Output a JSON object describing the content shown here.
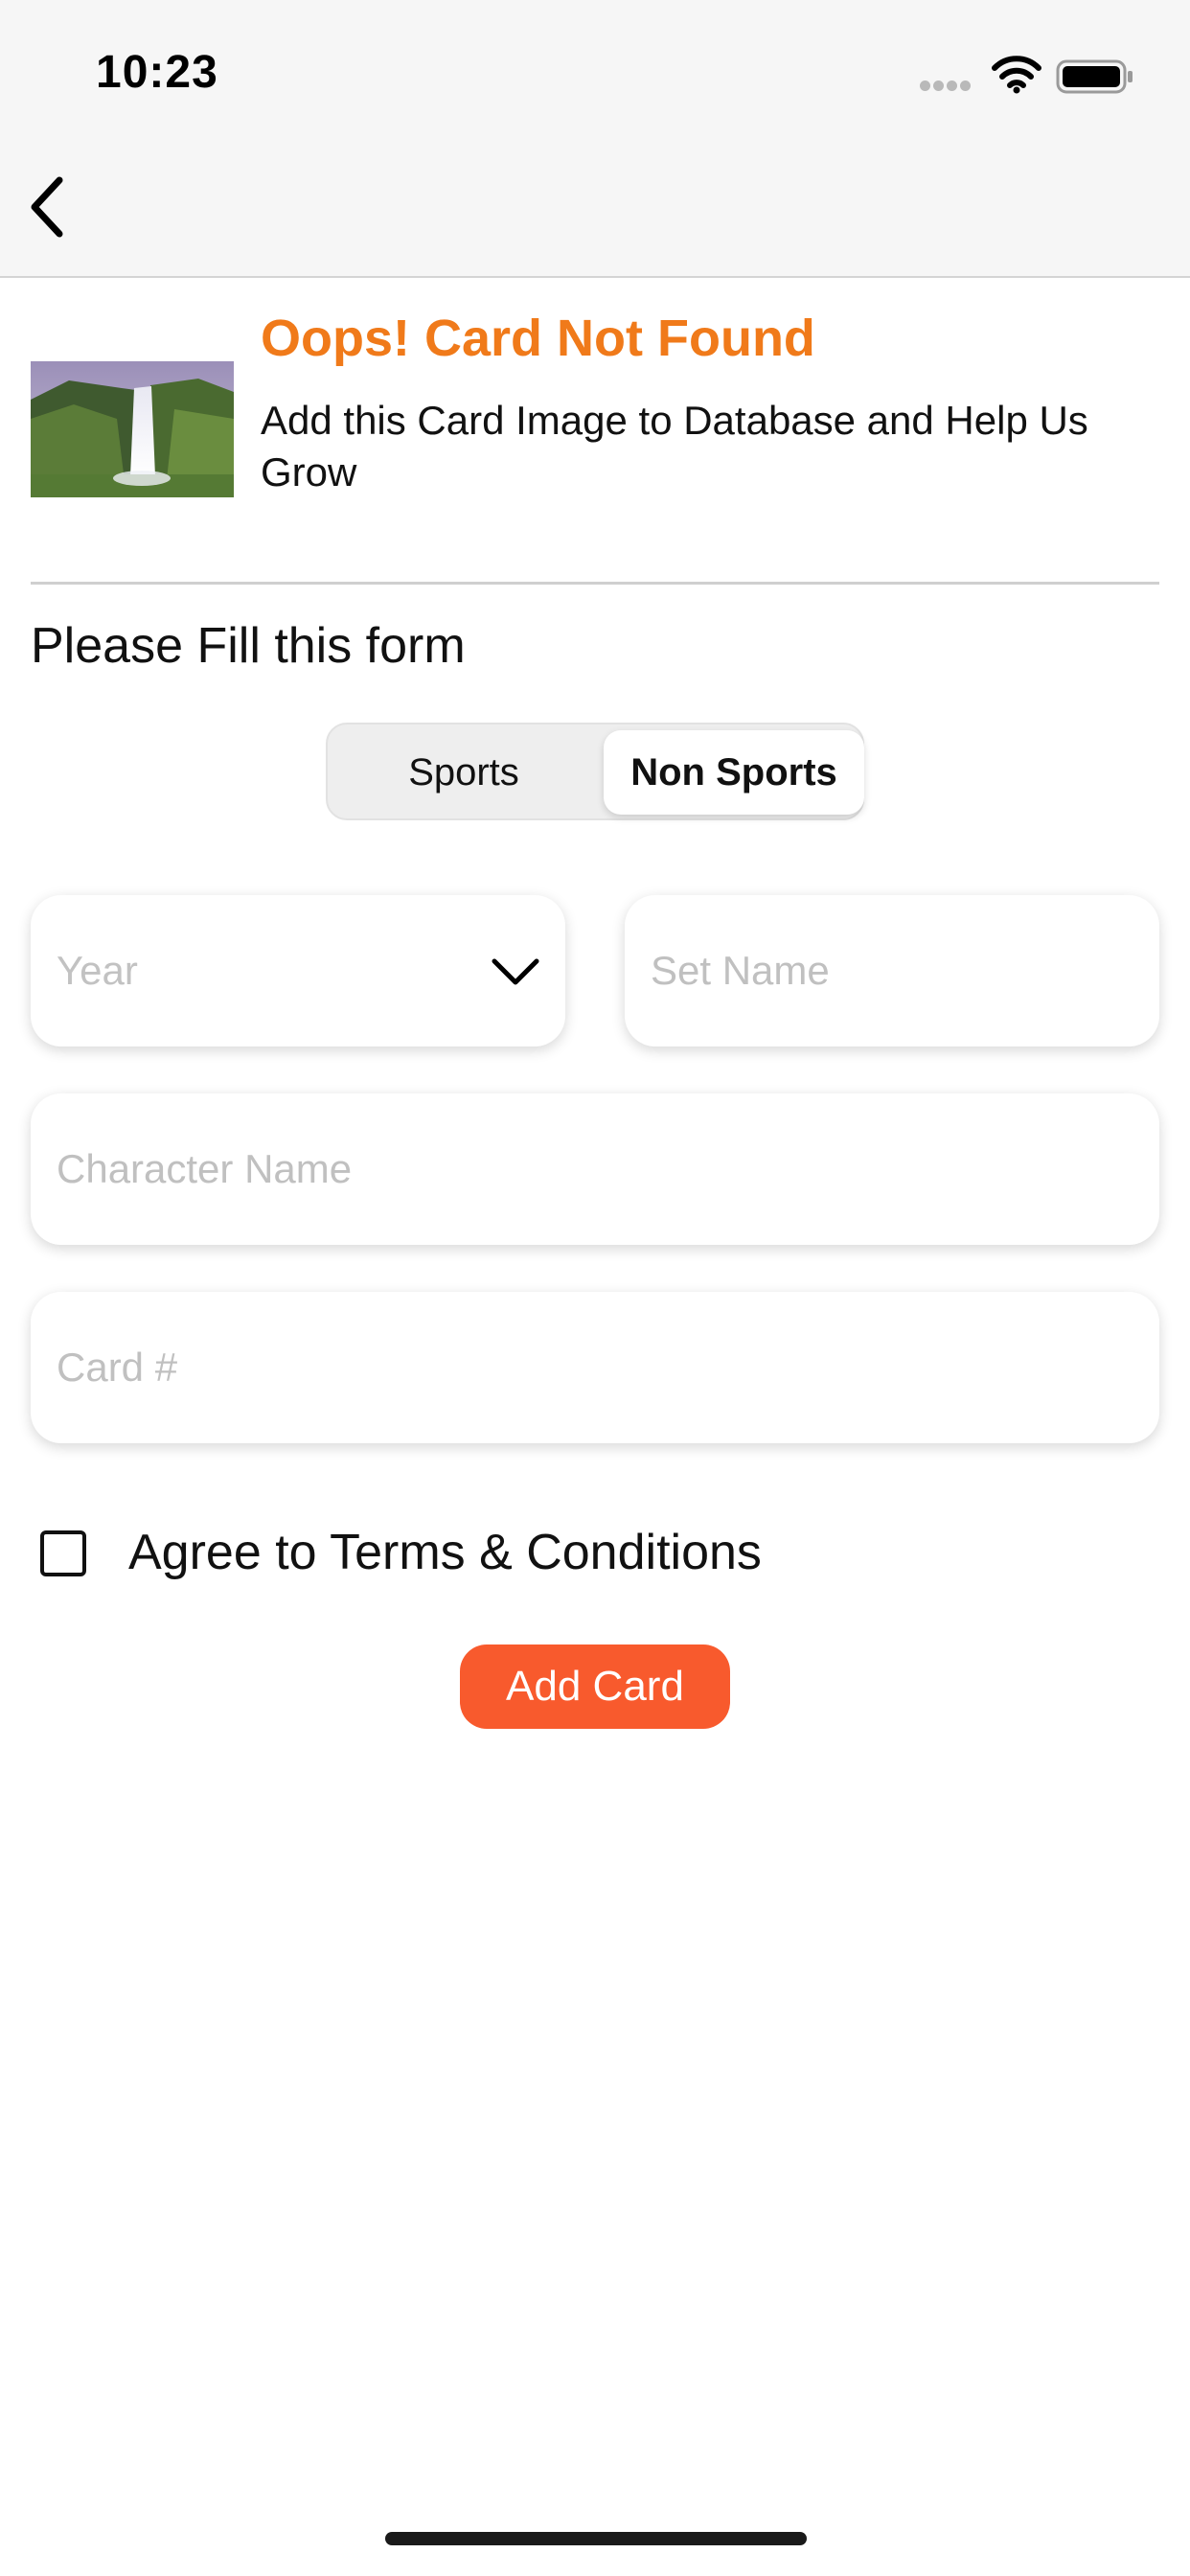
{
  "status_bar": {
    "time": "10:23",
    "icons": [
      "signal-icon",
      "wifi-icon",
      "battery-icon"
    ]
  },
  "nav": {
    "back_icon": "chevron-left-icon"
  },
  "notice": {
    "headline": "Oops! Card Not Found",
    "message": "Add this Card Image to Database and Help Us Grow",
    "image": "waterfall-thumbnail"
  },
  "form": {
    "title": "Please Fill this form",
    "segments": {
      "sports": "Sports",
      "non_sports": "Non Sports",
      "selected": "Non Sports"
    },
    "year": {
      "placeholder": "Year",
      "icon": "chevron-down-icon"
    },
    "set_name": {
      "placeholder": "Set Name"
    },
    "character_name": {
      "placeholder": "Character Name"
    },
    "card_number": {
      "placeholder": "Card #"
    },
    "terms_label": "Agree to Terms & Conditions",
    "terms_checked": false,
    "submit_label": "Add Card"
  },
  "colors": {
    "headline": "#f07a1a",
    "button": "#f85a2d",
    "nav_background": "#f6f6f6"
  }
}
